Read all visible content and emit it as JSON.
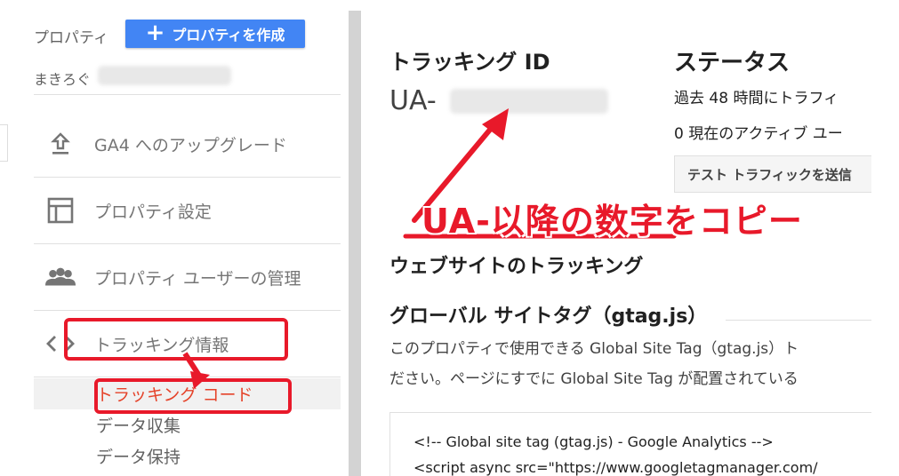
{
  "left": {
    "property_label": "プロパティ",
    "create_button": "プロパティを作成",
    "account_name": "まきろぐ",
    "nav": [
      {
        "label": "GA4 へのアップグレード",
        "icon": "upload-icon"
      },
      {
        "label": "プロパティ設定",
        "icon": "layout-icon"
      },
      {
        "label": "プロパティ ユーザーの管理",
        "icon": "people-icon"
      },
      {
        "label": "トラッキング情報",
        "icon": "code-icon"
      }
    ],
    "sub_items": [
      "トラッキング コード",
      "データ収集",
      "データ保持"
    ]
  },
  "main": {
    "tracking_id_title": "トラッキング ID",
    "tracking_id_prefix": "UA-",
    "status_title": "ステータス",
    "status_line1": "過去 48 時間にトラフィ",
    "status_line2": "0 現在のアクティブ ユー",
    "test_button": "テスト トラフィックを送信",
    "website_tracking": "ウェブサイトのトラッキング",
    "gtag_title": "グローバル サイトタグ（gtag.js）",
    "desc_line1": "このプロパティで使用できる Global Site Tag（gtag.js）ト",
    "desc_line2": "ださい。ページにすでに Global Site Tag が配置されている",
    "code_line1": "<!-- Global site tag (gtag.js) - Google Analytics -->",
    "code_line2": "<script async src=\"https://www.googletagmanager.com/"
  },
  "annotation": {
    "text": "UA-以降の数字をコピー",
    "color": "#e8192a"
  },
  "colors": {
    "accent": "#4285f4",
    "annotation": "#e8192a",
    "active_text": "#e5432a"
  }
}
